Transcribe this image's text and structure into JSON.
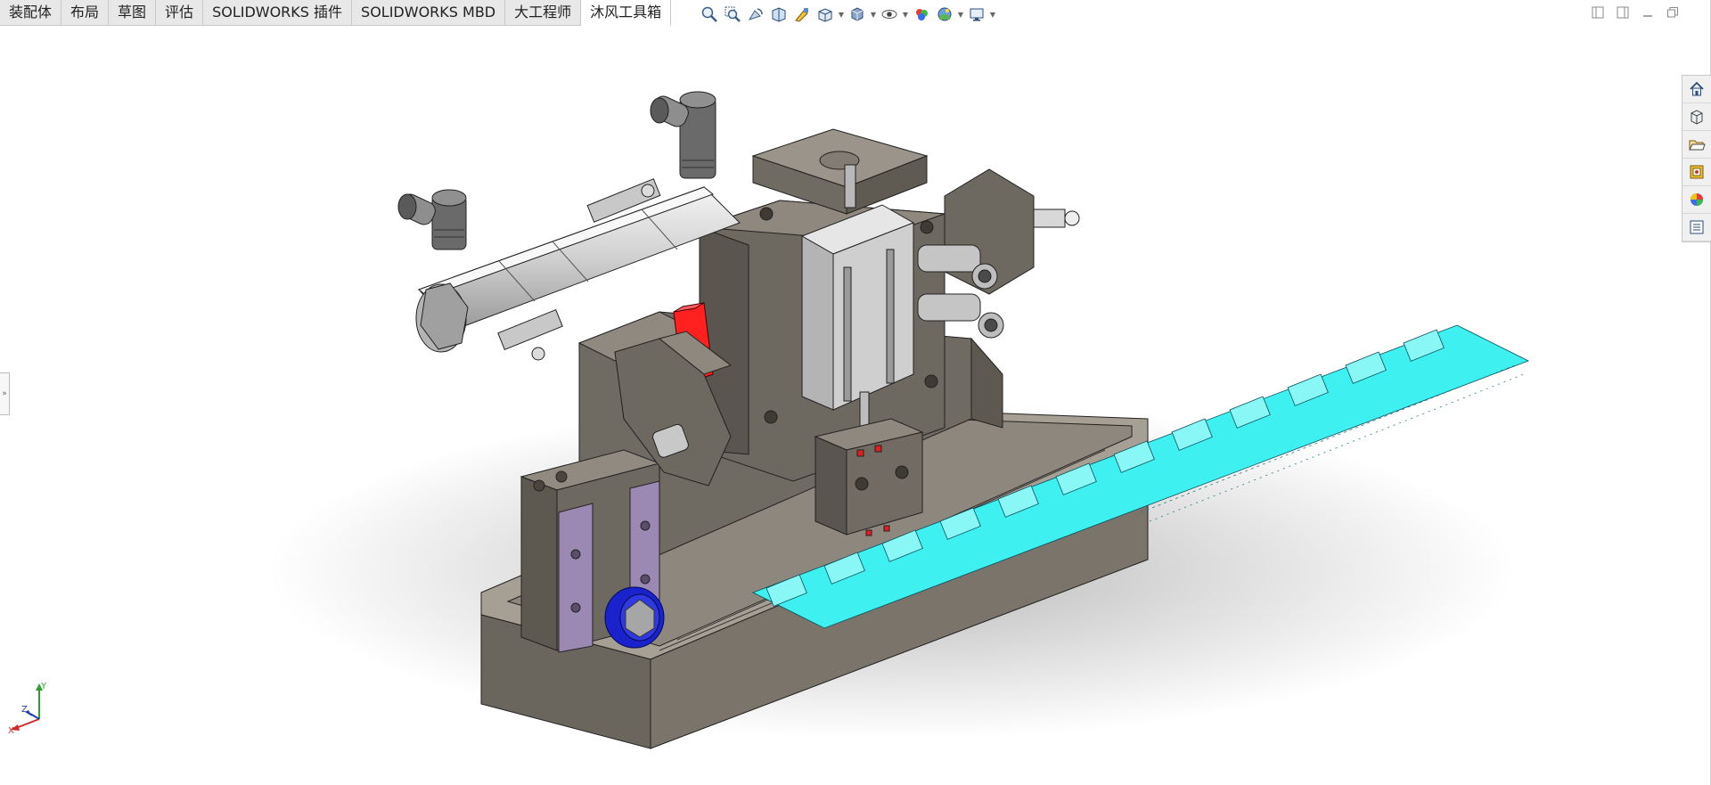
{
  "tabs": [
    {
      "label": "装配体",
      "active": false
    },
    {
      "label": "布局",
      "active": false
    },
    {
      "label": "草图",
      "active": false
    },
    {
      "label": "评估",
      "active": false
    },
    {
      "label": "SOLIDWORKS 插件",
      "active": false
    },
    {
      "label": "SOLIDWORKS MBD",
      "active": false
    },
    {
      "label": "大工程师",
      "active": false
    },
    {
      "label": "沐风工具箱",
      "active": true
    }
  ],
  "heads_up_toolbar": [
    "zoom-to-fit-icon",
    "zoom-to-area-icon",
    "previous-view-icon",
    "section-view-icon",
    "dynamic-annotation-icon",
    "view-orientation-icon",
    "display-style-icon",
    "hide-show-icon",
    "edit-appearance-icon",
    "apply-scene-icon",
    "view-settings-icon"
  ],
  "task_pane": [
    "home-icon",
    "parts-library-icon",
    "file-explorer-icon",
    "view-palette-icon",
    "appearances-icon",
    "custom-properties-icon"
  ],
  "triad": {
    "x": "X",
    "y": "Y",
    "z": "Z"
  },
  "colors": {
    "body": "#6d6860",
    "body_light": "#8a857c",
    "cylinder": "#d4d4d4",
    "strip": "#3ff0f0",
    "red_block": "#ff2020",
    "purple_plate": "#9b88b3",
    "blue_nut": "#1a22cc"
  }
}
